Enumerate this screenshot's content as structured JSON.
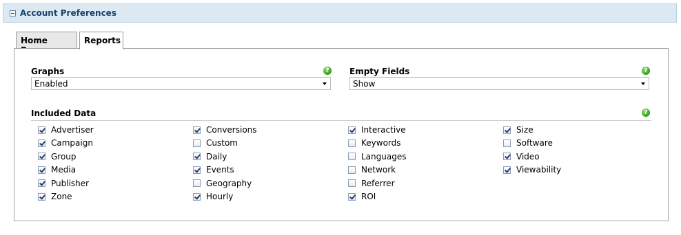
{
  "header": {
    "title": "Account Preferences"
  },
  "tabs": [
    {
      "label": "Home Page",
      "active": false
    },
    {
      "label": "Reports",
      "active": true
    }
  ],
  "graphs": {
    "label": "Graphs",
    "value": "Enabled"
  },
  "empty_fields": {
    "label": "Empty Fields",
    "value": "Show"
  },
  "included_data": {
    "label": "Included Data",
    "columns": [
      [
        {
          "label": "Advertiser",
          "checked": true
        },
        {
          "label": "Campaign",
          "checked": true
        },
        {
          "label": "Group",
          "checked": true
        },
        {
          "label": "Media",
          "checked": true
        },
        {
          "label": "Publisher",
          "checked": true
        },
        {
          "label": "Zone",
          "checked": true
        }
      ],
      [
        {
          "label": "Conversions",
          "checked": true
        },
        {
          "label": "Custom",
          "checked": false
        },
        {
          "label": "Daily",
          "checked": true
        },
        {
          "label": "Events",
          "checked": true
        },
        {
          "label": "Geography",
          "checked": false
        },
        {
          "label": "Hourly",
          "checked": true
        }
      ],
      [
        {
          "label": "Interactive",
          "checked": true
        },
        {
          "label": "Keywords",
          "checked": false
        },
        {
          "label": "Languages",
          "checked": false
        },
        {
          "label": "Network",
          "checked": false
        },
        {
          "label": "Referrer",
          "checked": false
        },
        {
          "label": "ROI",
          "checked": true
        }
      ],
      [
        {
          "label": "Size",
          "checked": true
        },
        {
          "label": "Software",
          "checked": false
        },
        {
          "label": "Video",
          "checked": true
        },
        {
          "label": "Viewability",
          "checked": true
        }
      ]
    ]
  },
  "help_icon_glyph": "?",
  "colors": {
    "header_bg": "#dce9f3",
    "title": "#17436b",
    "help": "#3fa52a"
  }
}
